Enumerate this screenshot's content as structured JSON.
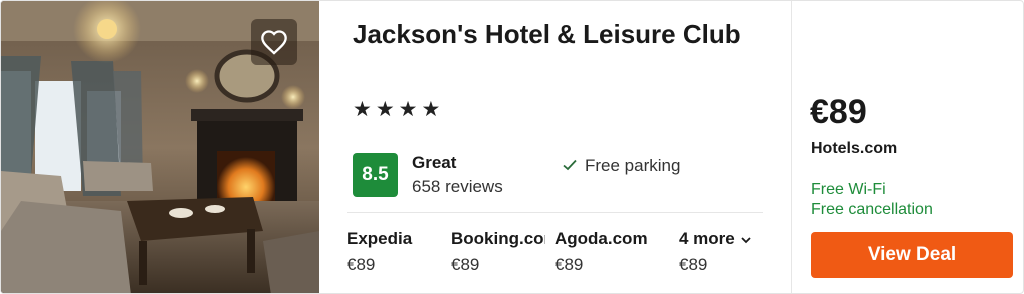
{
  "hotel": {
    "name": "Jackson's Hotel & Leisure Club",
    "stars": "★★★★",
    "rating_score": "8.5",
    "rating_word": "Great",
    "reviews": "658 reviews",
    "amenity": "Free parking",
    "rating_color": "#1e8c3a"
  },
  "providers": [
    {
      "name": "Expedia",
      "price": "€89"
    },
    {
      "name": "Booking.com",
      "price": "€89"
    },
    {
      "name": "Agoda.com",
      "price": "€89"
    },
    {
      "name": "4 more",
      "price": "€89"
    }
  ],
  "deal": {
    "price": "€89",
    "site": "Hotels.com",
    "perks": [
      "Free Wi-Fi",
      "Free cancellation"
    ],
    "button_label": "View Deal",
    "button_color": "#f05a14"
  },
  "icons": {
    "favorite": "heart-icon",
    "amenity": "checkmark-icon",
    "more": "chevron-down-icon"
  }
}
